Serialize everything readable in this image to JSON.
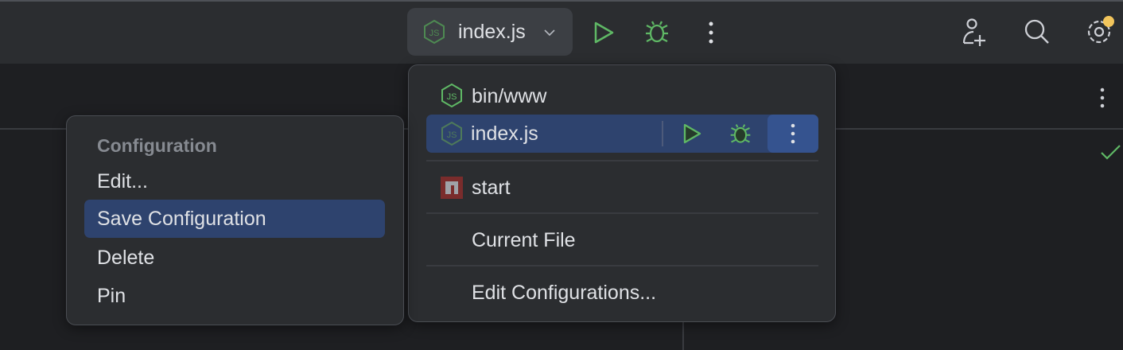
{
  "toolbar": {
    "run_config": {
      "label": "index.js",
      "icon": "nodejs-icon"
    },
    "run_icon": "play-icon",
    "debug_icon": "bug-icon",
    "more_icon": "more-vertical-icon",
    "add_user_icon": "add-user-icon",
    "search_icon": "search-icon",
    "settings_icon": "gear-icon"
  },
  "run_menu": {
    "items": [
      {
        "label": "bin/www",
        "icon": "nodejs-icon"
      },
      {
        "label": "index.js",
        "icon": "nodejs-icon",
        "selected": true
      },
      {
        "label": "start",
        "icon": "npm-icon"
      },
      {
        "label": "Current File"
      },
      {
        "label": "Edit Configurations..."
      }
    ]
  },
  "context_menu": {
    "header": "Configuration",
    "items": [
      {
        "label": "Edit..."
      },
      {
        "label": "Save Configuration",
        "selected": true
      },
      {
        "label": "Delete"
      },
      {
        "label": "Pin"
      }
    ]
  },
  "colors": {
    "accent_green": "#5fb865",
    "selection": "#2e436e",
    "badge": "#f2c55c"
  }
}
